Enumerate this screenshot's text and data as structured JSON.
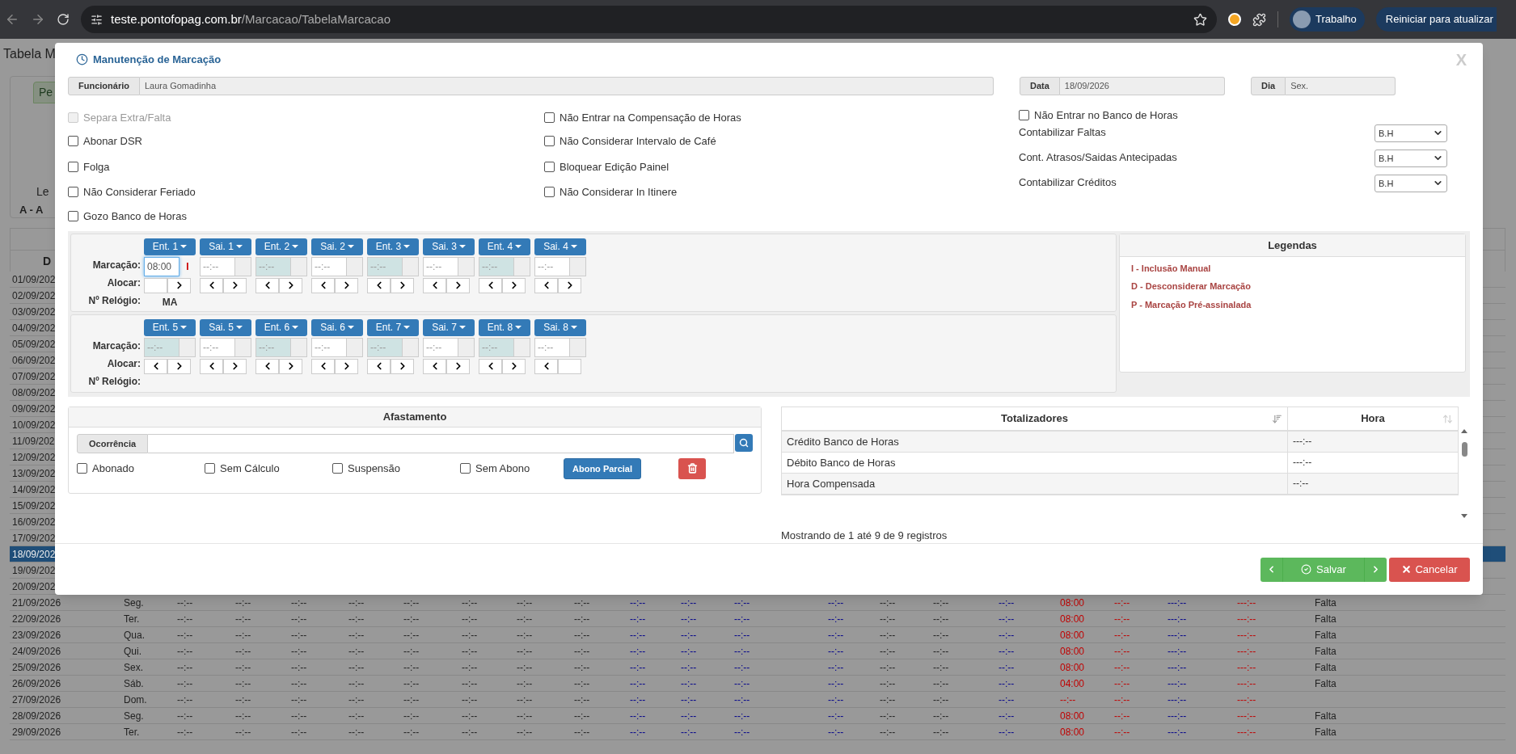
{
  "browser": {
    "url_host": "teste.pontofopag.com.br",
    "url_path": "/Marcacao/TabelaMarcacao",
    "profile": "Trabalho",
    "update": "Reiniciar para atualizar"
  },
  "background": {
    "title": "Tabela M",
    "panel_tab": "Pe",
    "legend_stub": "Le",
    "legend_item_stub": "A - A",
    "table_header": "D",
    "stub_rows": [
      {
        "date": "01/09/202",
        "selected": false
      },
      {
        "date": "02/09/202",
        "selected": false
      },
      {
        "date": "03/09/202",
        "selected": false
      },
      {
        "date": "04/09/202",
        "selected": false
      },
      {
        "date": "05/09/202",
        "selected": false
      },
      {
        "date": "06/09/202",
        "selected": false
      },
      {
        "date": "07/09/202",
        "selected": false
      },
      {
        "date": "08/09/202",
        "selected": false
      },
      {
        "date": "09/09/202",
        "selected": false
      },
      {
        "date": "10/09/202",
        "selected": false
      },
      {
        "date": "11/09/202",
        "selected": false
      },
      {
        "date": "12/09/202",
        "selected": false
      },
      {
        "date": "13/09/202",
        "selected": false
      },
      {
        "date": "14/09/202",
        "selected": false
      },
      {
        "date": "15/09/202",
        "selected": false
      },
      {
        "date": "16/09/202",
        "selected": false
      },
      {
        "date": "17/09/202",
        "selected": false
      },
      {
        "date": "18/09/202",
        "selected": true
      },
      {
        "date": "19/09/202",
        "selected": false
      },
      {
        "date": "20/09/202",
        "selected": false
      }
    ],
    "columns": [
      {
        "color": "#222222"
      },
      {
        "color": "#222222"
      },
      {
        "color": "#222222"
      },
      {
        "color": "#222222"
      },
      {
        "color": "#222222"
      },
      {
        "color": "#222222"
      },
      {
        "color": "#222222"
      },
      {
        "color": "#222222"
      },
      {
        "color": "#222222"
      },
      {
        "color": "#222222"
      },
      {
        "color": "#00008b"
      },
      {
        "color": "#00008b"
      },
      {
        "color": "#00008b"
      },
      {
        "color": "#00008b"
      },
      {
        "color": "#222222"
      },
      {
        "color": "#222222"
      },
      {
        "color": "#00008b"
      },
      {
        "color": "#c00000"
      },
      {
        "color": "#c00000"
      },
      {
        "color": "#00008b"
      },
      {
        "color": "#c00000"
      },
      {
        "color": "#222222"
      }
    ],
    "rows": [
      {
        "cells": [
          "21/09/2026",
          "Seg.",
          "--:--",
          "--:--",
          "--:--",
          "--:--",
          "--:--",
          "--:--",
          "--:--",
          "--:--",
          "--:--",
          "--:--",
          "--:--",
          "--:--",
          "--:--",
          "--:--",
          "--:--",
          "08:00",
          "--:--",
          "---:--",
          "---:--",
          "Falta"
        ]
      },
      {
        "cells": [
          "22/09/2026",
          "Ter.",
          "--:--",
          "--:--",
          "--:--",
          "--:--",
          "--:--",
          "--:--",
          "--:--",
          "--:--",
          "--:--",
          "--:--",
          "--:--",
          "--:--",
          "--:--",
          "--:--",
          "--:--",
          "08:00",
          "--:--",
          "---:--",
          "---:--",
          "Falta"
        ]
      },
      {
        "cells": [
          "23/09/2026",
          "Qua.",
          "--:--",
          "--:--",
          "--:--",
          "--:--",
          "--:--",
          "--:--",
          "--:--",
          "--:--",
          "--:--",
          "--:--",
          "--:--",
          "--:--",
          "--:--",
          "--:--",
          "--:--",
          "08:00",
          "--:--",
          "---:--",
          "---:--",
          "Falta"
        ]
      },
      {
        "cells": [
          "24/09/2026",
          "Qui.",
          "--:--",
          "--:--",
          "--:--",
          "--:--",
          "--:--",
          "--:--",
          "--:--",
          "--:--",
          "--:--",
          "--:--",
          "--:--",
          "--:--",
          "--:--",
          "--:--",
          "--:--",
          "08:00",
          "--:--",
          "---:--",
          "---:--",
          "Falta"
        ]
      },
      {
        "cells": [
          "25/09/2026",
          "Sex.",
          "--:--",
          "--:--",
          "--:--",
          "--:--",
          "--:--",
          "--:--",
          "--:--",
          "--:--",
          "--:--",
          "--:--",
          "--:--",
          "--:--",
          "--:--",
          "--:--",
          "--:--",
          "08:00",
          "--:--",
          "---:--",
          "---:--",
          "Falta"
        ]
      },
      {
        "cells": [
          "26/09/2026",
          "Sáb.",
          "--:--",
          "--:--",
          "--:--",
          "--:--",
          "--:--",
          "--:--",
          "--:--",
          "--:--",
          "--:--",
          "--:--",
          "--:--",
          "--:--",
          "--:--",
          "--:--",
          "--:--",
          "04:00",
          "--:--",
          "---:--",
          "---:--",
          "Falta"
        ]
      },
      {
        "cells": [
          "27/09/2026",
          "Dom.",
          "--:--",
          "--:--",
          "--:--",
          "--:--",
          "--:--",
          "--:--",
          "--:--",
          "--:--",
          "--:--",
          "--:--",
          "--:--",
          "--:--",
          "--:--",
          "--:--",
          "--:--",
          "--:--",
          "--:--",
          "---:--",
          "---:--",
          ""
        ]
      },
      {
        "cells": [
          "28/09/2026",
          "Seg.",
          "--:--",
          "--:--",
          "--:--",
          "--:--",
          "--:--",
          "--:--",
          "--:--",
          "--:--",
          "--:--",
          "--:--",
          "--:--",
          "--:--",
          "--:--",
          "--:--",
          "--:--",
          "08:00",
          "--:--",
          "---:--",
          "---:--",
          "Falta"
        ]
      },
      {
        "cells": [
          "29/09/2026",
          "Ter.",
          "--:--",
          "--:--",
          "--:--",
          "--:--",
          "--:--",
          "--:--",
          "--:--",
          "--:--",
          "--:--",
          "--:--",
          "--:--",
          "--:--",
          "--:--",
          "--:--",
          "--:--",
          "08:00",
          "--:--",
          "---:--",
          "---:--",
          "Falta"
        ]
      }
    ]
  },
  "modal": {
    "title": "Manutenção de Marcação",
    "close": "X",
    "fields": [
      {
        "label": "Funcionário",
        "value": "Laura Gomadinha"
      },
      {
        "label": "Data",
        "value": "18/09/2026"
      },
      {
        "label": "Dia",
        "value": "Sex."
      }
    ],
    "options_col1": [
      {
        "label": "Separa Extra/Falta",
        "checked": false,
        "disabled": true
      },
      {
        "label": "Abonar DSR",
        "checked": false,
        "disabled": false
      },
      {
        "label": "Folga",
        "checked": false,
        "disabled": false
      },
      {
        "label": "Não Considerar Feriado",
        "checked": false,
        "disabled": false
      },
      {
        "label": "Gozo Banco de Horas",
        "checked": false,
        "disabled": false
      }
    ],
    "options_col2": [
      {
        "label": "Não Entrar na Compensação de Horas",
        "checked": false,
        "disabled": false
      },
      {
        "label": "Não Considerar Intervalo de Café",
        "checked": false,
        "disabled": false
      },
      {
        "label": "Bloquear Edição Painel",
        "checked": false,
        "disabled": false
      },
      {
        "label": "Não Considerar In Itinere",
        "checked": false,
        "disabled": false
      }
    ],
    "option_col3": {
      "label": "Não Entrar no Banco de Horas",
      "checked": false,
      "disabled": false
    },
    "selects": [
      {
        "label": "Contabilizar Faltas",
        "value": "B.H"
      },
      {
        "label": "Cont. Atrasos/Saidas Antecipadas",
        "value": "B.H"
      },
      {
        "label": "Contabilizar Créditos",
        "value": "B.H"
      }
    ],
    "groups": [
      {
        "labels": {
          "marcacao": "Marcação:",
          "alocar": "Alocar:",
          "relogio": "Nº Relógio:"
        },
        "slots": [
          {
            "name": "Ent. 1",
            "time": "08:00",
            "focused": true,
            "shaded": false,
            "flag": "I",
            "left": false,
            "right": true,
            "relogio": "MA"
          },
          {
            "name": "Sai. 1",
            "placeholder": "--:--",
            "focused": false,
            "shaded": false,
            "left": true,
            "right": true
          },
          {
            "name": "Ent. 2",
            "placeholder": "--:--",
            "focused": false,
            "shaded": true,
            "left": true,
            "right": true
          },
          {
            "name": "Sai. 2",
            "placeholder": "--:--",
            "focused": false,
            "shaded": false,
            "left": true,
            "right": true
          },
          {
            "name": "Ent. 3",
            "placeholder": "--:--",
            "focused": false,
            "shaded": true,
            "left": true,
            "right": true
          },
          {
            "name": "Sai. 3",
            "placeholder": "--:--",
            "focused": false,
            "shaded": false,
            "left": true,
            "right": true
          },
          {
            "name": "Ent. 4",
            "placeholder": "--:--",
            "focused": false,
            "shaded": true,
            "left": true,
            "right": true
          },
          {
            "name": "Sai. 4",
            "placeholder": "--:--",
            "focused": false,
            "shaded": false,
            "left": true,
            "right": true
          }
        ]
      },
      {
        "labels": {
          "marcacao": "Marcação:",
          "alocar": "Alocar:",
          "relogio": "Nº Relógio:"
        },
        "slots": [
          {
            "name": "Ent. 5",
            "placeholder": "--:--",
            "focused": false,
            "shaded": true,
            "left": true,
            "right": true
          },
          {
            "name": "Sai. 5",
            "placeholder": "--:--",
            "focused": false,
            "shaded": false,
            "left": true,
            "right": true
          },
          {
            "name": "Ent. 6",
            "placeholder": "--:--",
            "focused": false,
            "shaded": true,
            "left": true,
            "right": true
          },
          {
            "name": "Sai. 6",
            "placeholder": "--:--",
            "focused": false,
            "shaded": false,
            "left": true,
            "right": true
          },
          {
            "name": "Ent. 7",
            "placeholder": "--:--",
            "focused": false,
            "shaded": true,
            "left": true,
            "right": true
          },
          {
            "name": "Sai. 7",
            "placeholder": "--:--",
            "focused": false,
            "shaded": false,
            "left": true,
            "right": true
          },
          {
            "name": "Ent. 8",
            "placeholder": "--:--",
            "focused": false,
            "shaded": true,
            "left": true,
            "right": true
          },
          {
            "name": "Sai. 8",
            "placeholder": "--:--",
            "focused": false,
            "shaded": false,
            "left": true,
            "right": false
          }
        ]
      }
    ],
    "legend": {
      "title": "Legendas",
      "items": [
        "I - Inclusão Manual",
        "D - Desconsiderar Marcação",
        "P - Marcação Pré-assinalada"
      ]
    },
    "afastamento": {
      "title": "Afastamento",
      "ocorrencia_label": "Ocorrência",
      "options": [
        {
          "label": "Abonado",
          "checked": false
        },
        {
          "label": "Sem Cálculo",
          "checked": false
        },
        {
          "label": "Suspensão",
          "checked": false
        },
        {
          "label": "Sem Abono",
          "checked": false
        }
      ],
      "abono_button": "Abono Parcial"
    },
    "totalizadores": {
      "columns": [
        "Totalizadores",
        "Hora"
      ],
      "rows": [
        [
          "Crédito Banco de Horas",
          "---:--"
        ],
        [
          "Débito Banco de Horas",
          "---:--"
        ],
        [
          "Hora Compensada",
          "--:--"
        ]
      ],
      "info": "Mostrando de 1 até 9 de 9 registros"
    },
    "footer": {
      "save": "Salvar",
      "cancel": "Cancelar"
    }
  }
}
